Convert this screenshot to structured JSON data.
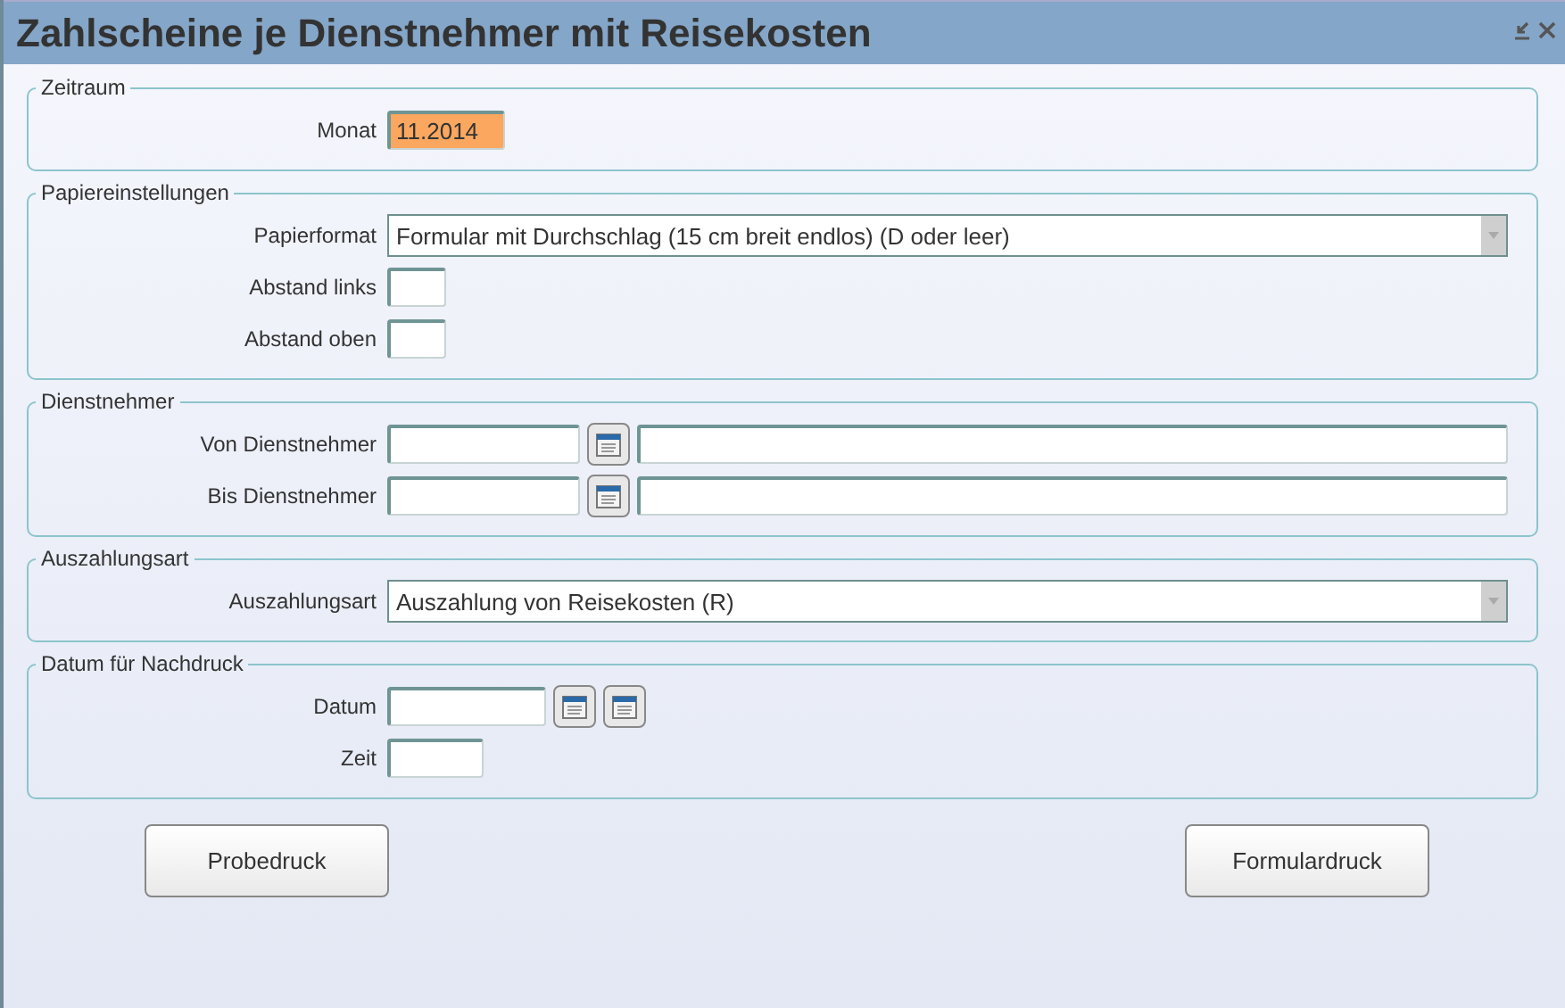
{
  "window": {
    "title": "Zahlscheine je Dienstnehmer mit Reisekosten"
  },
  "sections": [
    {
      "title": "Zeitraum",
      "rows": [
        {
          "label": "Monat",
          "controls": [
            {
              "kind": "month",
              "value": "11.2014",
              "highlighted": true
            }
          ]
        }
      ]
    },
    {
      "title": "Papiereinstellungen",
      "rows": [
        {
          "label": "Papierformat",
          "controls": [
            {
              "kind": "select",
              "value": "Formular mit Durchschlag (15 cm breit endlos) (D oder leer)"
            }
          ]
        },
        {
          "label": "Abstand links",
          "controls": [
            {
              "kind": "small"
            }
          ]
        },
        {
          "label": "Abstand oben",
          "controls": [
            {
              "kind": "small"
            }
          ]
        }
      ]
    },
    {
      "title": "Dienstnehmer",
      "rows": [
        {
          "label": "Von Dienstnehmer",
          "controls": [
            {
              "kind": "code"
            },
            {
              "kind": "picker"
            },
            {
              "kind": "name"
            }
          ]
        },
        {
          "label": "Bis Dienstnehmer",
          "controls": [
            {
              "kind": "code"
            },
            {
              "kind": "picker"
            },
            {
              "kind": "name"
            }
          ]
        }
      ]
    },
    {
      "title": "Auszahlungsart",
      "rows": [
        {
          "label": "Auszahlungsart",
          "controls": [
            {
              "kind": "select",
              "value": "Auszahlung von Reisekosten (R)"
            }
          ]
        }
      ]
    },
    {
      "title": "Datum für Nachdruck",
      "rows": [
        {
          "label": "Datum",
          "controls": [
            {
              "kind": "date"
            },
            {
              "kind": "picker"
            },
            {
              "kind": "picker"
            }
          ]
        },
        {
          "label": "Zeit",
          "controls": [
            {
              "kind": "time"
            }
          ]
        }
      ]
    }
  ],
  "buttons": [
    {
      "label": "Probedruck"
    },
    {
      "label": "Formulardruck"
    }
  ]
}
